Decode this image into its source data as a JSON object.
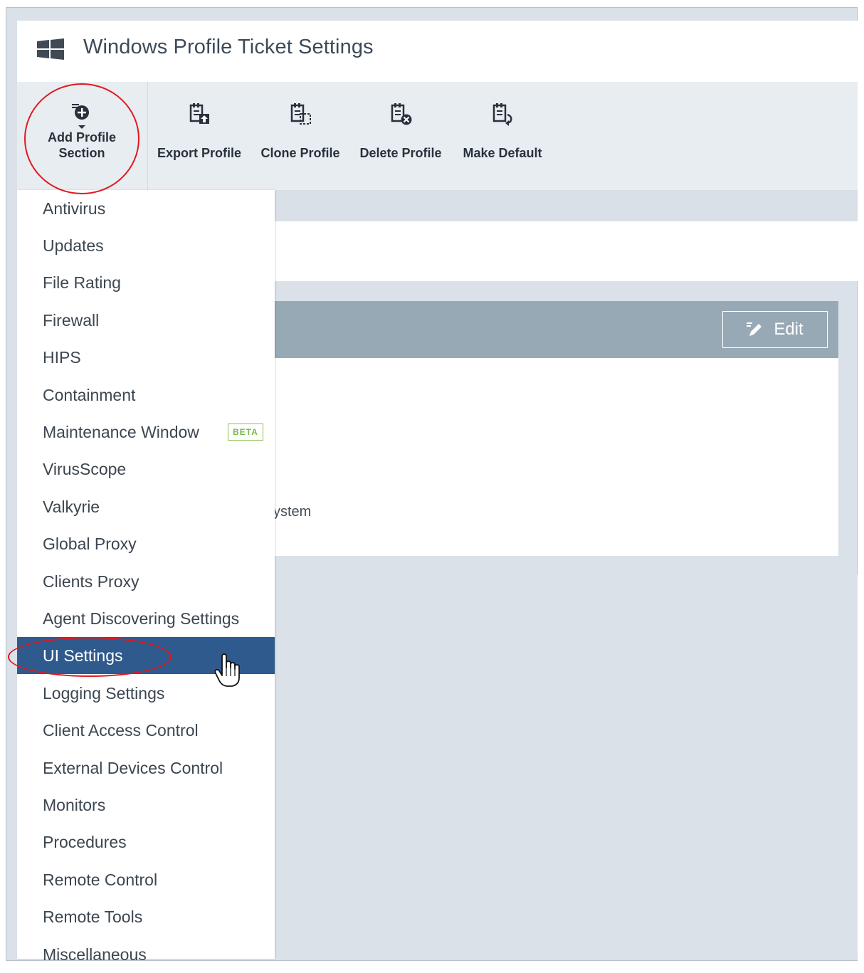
{
  "header": {
    "title": "Windows Profile Ticket Settings"
  },
  "toolbar": {
    "add_label_1": "Add Profile",
    "add_label_2": "Section",
    "export_label": "Export Profile",
    "clone_label": "Clone Profile",
    "delete_label": "Delete Profile",
    "default_label": "Make Default"
  },
  "section": {
    "edit_label": "Edit",
    "partial_text": "ystem"
  },
  "menu": {
    "items": [
      "Antivirus",
      "Updates",
      "File Rating",
      "Firewall",
      "HIPS",
      "Containment",
      "Maintenance Window",
      "VirusScope",
      "Valkyrie",
      "Global Proxy",
      "Clients Proxy",
      "Agent Discovering Settings",
      "UI Settings",
      "Logging Settings",
      "Client Access Control",
      "External Devices Control",
      "Monitors",
      "Procedures",
      "Remote Control",
      "Remote Tools",
      "Miscellaneous"
    ],
    "beta_badge": "BETA",
    "selected_index": 12
  },
  "colors": {
    "selected_bg": "#2f5a8e",
    "annotation_red": "#e0191f",
    "beta_green": "#7ab648"
  }
}
